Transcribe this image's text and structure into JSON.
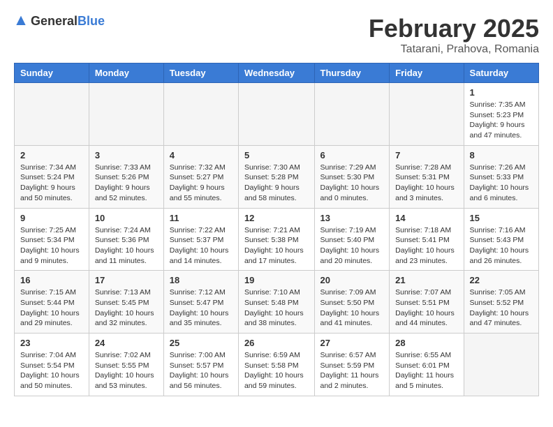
{
  "header": {
    "logo_general": "General",
    "logo_blue": "Blue",
    "month_year": "February 2025",
    "location": "Tatarani, Prahova, Romania"
  },
  "days_of_week": [
    "Sunday",
    "Monday",
    "Tuesday",
    "Wednesday",
    "Thursday",
    "Friday",
    "Saturday"
  ],
  "weeks": [
    [
      {
        "day": "",
        "info": ""
      },
      {
        "day": "",
        "info": ""
      },
      {
        "day": "",
        "info": ""
      },
      {
        "day": "",
        "info": ""
      },
      {
        "day": "",
        "info": ""
      },
      {
        "day": "",
        "info": ""
      },
      {
        "day": "1",
        "info": "Sunrise: 7:35 AM\nSunset: 5:23 PM\nDaylight: 9 hours and 47 minutes."
      }
    ],
    [
      {
        "day": "2",
        "info": "Sunrise: 7:34 AM\nSunset: 5:24 PM\nDaylight: 9 hours and 50 minutes."
      },
      {
        "day": "3",
        "info": "Sunrise: 7:33 AM\nSunset: 5:26 PM\nDaylight: 9 hours and 52 minutes."
      },
      {
        "day": "4",
        "info": "Sunrise: 7:32 AM\nSunset: 5:27 PM\nDaylight: 9 hours and 55 minutes."
      },
      {
        "day": "5",
        "info": "Sunrise: 7:30 AM\nSunset: 5:28 PM\nDaylight: 9 hours and 58 minutes."
      },
      {
        "day": "6",
        "info": "Sunrise: 7:29 AM\nSunset: 5:30 PM\nDaylight: 10 hours and 0 minutes."
      },
      {
        "day": "7",
        "info": "Sunrise: 7:28 AM\nSunset: 5:31 PM\nDaylight: 10 hours and 3 minutes."
      },
      {
        "day": "8",
        "info": "Sunrise: 7:26 AM\nSunset: 5:33 PM\nDaylight: 10 hours and 6 minutes."
      }
    ],
    [
      {
        "day": "9",
        "info": "Sunrise: 7:25 AM\nSunset: 5:34 PM\nDaylight: 10 hours and 9 minutes."
      },
      {
        "day": "10",
        "info": "Sunrise: 7:24 AM\nSunset: 5:36 PM\nDaylight: 10 hours and 11 minutes."
      },
      {
        "day": "11",
        "info": "Sunrise: 7:22 AM\nSunset: 5:37 PM\nDaylight: 10 hours and 14 minutes."
      },
      {
        "day": "12",
        "info": "Sunrise: 7:21 AM\nSunset: 5:38 PM\nDaylight: 10 hours and 17 minutes."
      },
      {
        "day": "13",
        "info": "Sunrise: 7:19 AM\nSunset: 5:40 PM\nDaylight: 10 hours and 20 minutes."
      },
      {
        "day": "14",
        "info": "Sunrise: 7:18 AM\nSunset: 5:41 PM\nDaylight: 10 hours and 23 minutes."
      },
      {
        "day": "15",
        "info": "Sunrise: 7:16 AM\nSunset: 5:43 PM\nDaylight: 10 hours and 26 minutes."
      }
    ],
    [
      {
        "day": "16",
        "info": "Sunrise: 7:15 AM\nSunset: 5:44 PM\nDaylight: 10 hours and 29 minutes."
      },
      {
        "day": "17",
        "info": "Sunrise: 7:13 AM\nSunset: 5:45 PM\nDaylight: 10 hours and 32 minutes."
      },
      {
        "day": "18",
        "info": "Sunrise: 7:12 AM\nSunset: 5:47 PM\nDaylight: 10 hours and 35 minutes."
      },
      {
        "day": "19",
        "info": "Sunrise: 7:10 AM\nSunset: 5:48 PM\nDaylight: 10 hours and 38 minutes."
      },
      {
        "day": "20",
        "info": "Sunrise: 7:09 AM\nSunset: 5:50 PM\nDaylight: 10 hours and 41 minutes."
      },
      {
        "day": "21",
        "info": "Sunrise: 7:07 AM\nSunset: 5:51 PM\nDaylight: 10 hours and 44 minutes."
      },
      {
        "day": "22",
        "info": "Sunrise: 7:05 AM\nSunset: 5:52 PM\nDaylight: 10 hours and 47 minutes."
      }
    ],
    [
      {
        "day": "23",
        "info": "Sunrise: 7:04 AM\nSunset: 5:54 PM\nDaylight: 10 hours and 50 minutes."
      },
      {
        "day": "24",
        "info": "Sunrise: 7:02 AM\nSunset: 5:55 PM\nDaylight: 10 hours and 53 minutes."
      },
      {
        "day": "25",
        "info": "Sunrise: 7:00 AM\nSunset: 5:57 PM\nDaylight: 10 hours and 56 minutes."
      },
      {
        "day": "26",
        "info": "Sunrise: 6:59 AM\nSunset: 5:58 PM\nDaylight: 10 hours and 59 minutes."
      },
      {
        "day": "27",
        "info": "Sunrise: 6:57 AM\nSunset: 5:59 PM\nDaylight: 11 hours and 2 minutes."
      },
      {
        "day": "28",
        "info": "Sunrise: 6:55 AM\nSunset: 6:01 PM\nDaylight: 11 hours and 5 minutes."
      },
      {
        "day": "",
        "info": ""
      }
    ]
  ]
}
